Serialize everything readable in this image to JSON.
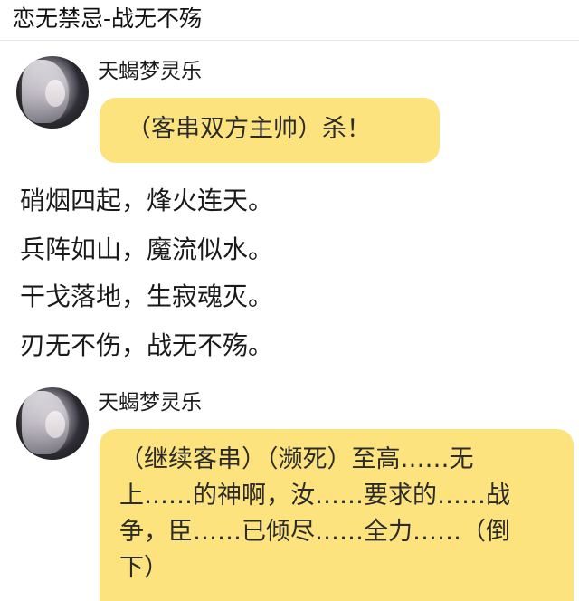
{
  "header": {
    "title": "恋无禁忌-战无不殇"
  },
  "messages": [
    {
      "username": "天蝎梦灵乐",
      "avatar_icon": "user-avatar-icon",
      "bubble_text": "（客串双方主帅）杀！"
    },
    {
      "username": "天蝎梦灵乐",
      "avatar_icon": "user-avatar-icon",
      "bubble_lines": [
        "（继续客串）（濒死）至高……无",
        "上……的神啊，汝……要求的……战",
        "争，臣……已倾尽……全力……（倒",
        "下）"
      ]
    }
  ],
  "poem": [
    "硝烟四起，烽火连天。",
    "兵阵如山，魔流似水。",
    "干戈落地，生寂魂灭。",
    "刃无不伤，战无不殇。"
  ],
  "colors": {
    "bubble": "#fde37e",
    "text": "#1a1a1a"
  }
}
